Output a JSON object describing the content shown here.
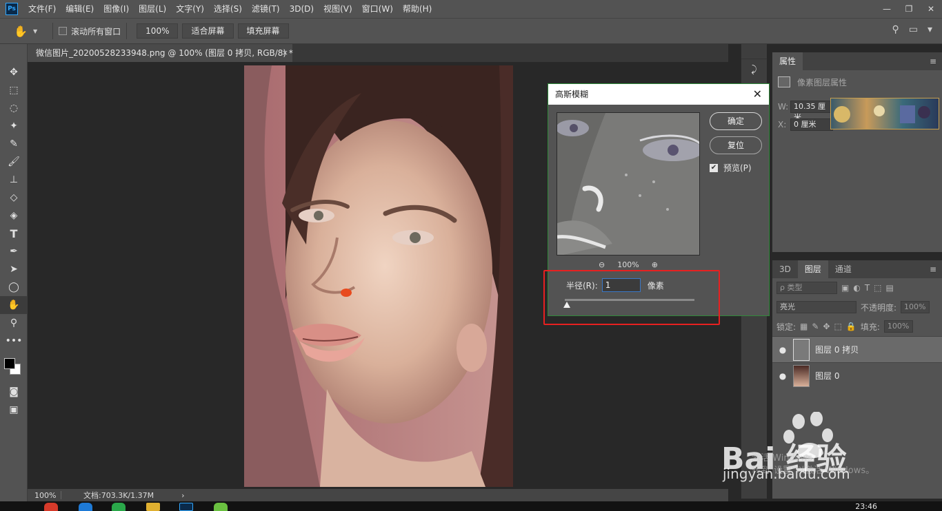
{
  "menubar": {
    "logo": "Ps",
    "items": [
      "文件(F)",
      "编辑(E)",
      "图像(I)",
      "图层(L)",
      "文字(Y)",
      "选择(S)",
      "滤镜(T)",
      "3D(D)",
      "视图(V)",
      "窗口(W)",
      "帮助(H)"
    ],
    "window_controls": [
      "—",
      "❐",
      "✕"
    ]
  },
  "options": {
    "scroll_all": "滚动所有窗口",
    "zoom": "100%",
    "fit_screen": "适合屏幕",
    "fill_screen": "填充屏幕"
  },
  "document": {
    "tab_title": "微信图片_20200528233948.png @ 100% (图层 0 拷贝, RGB/8) *",
    "tab_close": "×",
    "status_zoom": "100%",
    "status_doc": "文档:703.3K/1.37M",
    "status_arrow": "›"
  },
  "dialog": {
    "title": "高斯模糊",
    "close": "✕",
    "ok": "确定",
    "reset": "复位",
    "preview_label": "预览(P)",
    "preview_checked": true,
    "preview_zoom": "100%",
    "radius_label": "半径(R):",
    "radius_value": "1",
    "radius_unit": "像素",
    "radius_slider_fraction": 0.0
  },
  "properties": {
    "tab": "属性",
    "section": "像素图层属性",
    "w_label": "W:",
    "w_value": "10.35 厘米",
    "x_label": "X:",
    "x_value": "0 厘米"
  },
  "layers": {
    "tabs": [
      "3D",
      "图层",
      "通道"
    ],
    "active_tab": "图层",
    "filter_kind": "ρ 类型",
    "blend_mode": "亮光",
    "opacity_label": "不透明度:",
    "opacity_value": "100%",
    "lock_label": "锁定:",
    "fill_label": "填充:",
    "fill_value": "100%",
    "items": [
      {
        "name": "图层 0 拷贝",
        "selected": true,
        "visible": "●"
      },
      {
        "name": "图层 0",
        "selected": false,
        "visible": "●"
      }
    ]
  },
  "taskbar": {
    "clock": "23:46"
  },
  "watermark": {
    "brand": "Bai  经验",
    "url": "jingyan.baidu.com",
    "activate_1": "激活 Windows",
    "activate_2": "转到\"设置\"以激活 Windows。"
  },
  "colors": {
    "highlight": "#e82020",
    "panel": "#535353",
    "canvas": "#282828",
    "accent": "#31a8ff"
  }
}
